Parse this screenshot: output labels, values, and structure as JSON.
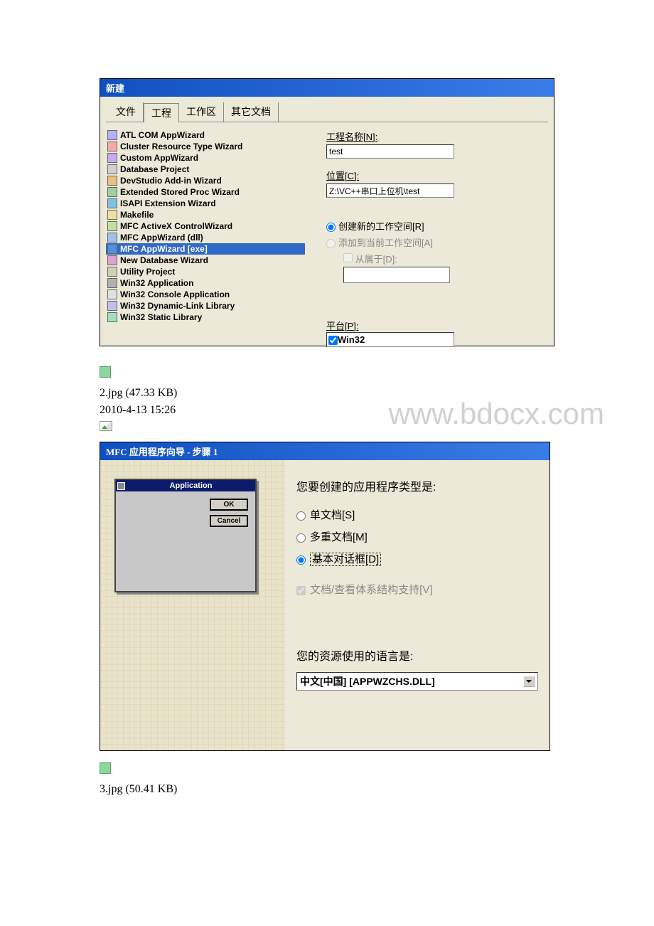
{
  "dialog1": {
    "title": "新建",
    "tabs": [
      "文件",
      "工程",
      "工作区",
      "其它文档"
    ],
    "active_tab": 1,
    "projects": [
      "ATL COM AppWizard",
      "Cluster Resource Type Wizard",
      "Custom AppWizard",
      "Database Project",
      "DevStudio Add-in Wizard",
      "Extended Stored Proc Wizard",
      "ISAPI Extension Wizard",
      "Makefile",
      "MFC ActiveX ControlWizard",
      "MFC AppWizard (dll)",
      "MFC AppWizard [exe]",
      "New Database Wizard",
      "Utility Project",
      "Win32 Application",
      "Win32 Console Application",
      "Win32 Dynamic-Link Library",
      "Win32 Static Library"
    ],
    "selected_index": 10,
    "name_label": "工程名称[N]:",
    "name_value": "test",
    "location_label": "位置[C]:",
    "location_value": "Z:\\VC++串口上位机\\test",
    "radio_new": "创建新的工作空间[R]",
    "radio_add": "添加到当前工作空间[A]",
    "check_depend": "从属于[D]:",
    "platform_label": "平台[P]:",
    "platform_value": "Win32"
  },
  "caption1": "2.jpg (47.33 KB)",
  "timestamp1": "2010-4-13 15:26",
  "watermark": "www.bdocx.com",
  "dialog2": {
    "title": "MFC 应用程序向导 - 步骤 1",
    "preview_title": "Application",
    "preview_ok": "OK",
    "preview_cancel": "Cancel",
    "question1": "您要创建的应用程序类型是:",
    "opt_single": "单文档[S]",
    "opt_multi": "多重文档[M]",
    "opt_dialog": "基本对话框[D]",
    "check_docview": "文档/查看体系结构支持[V]",
    "question2": "您的资源使用的语言是:",
    "language": "中文[中国] [APPWZCHS.DLL]"
  },
  "caption2": "3.jpg (50.41 KB)"
}
